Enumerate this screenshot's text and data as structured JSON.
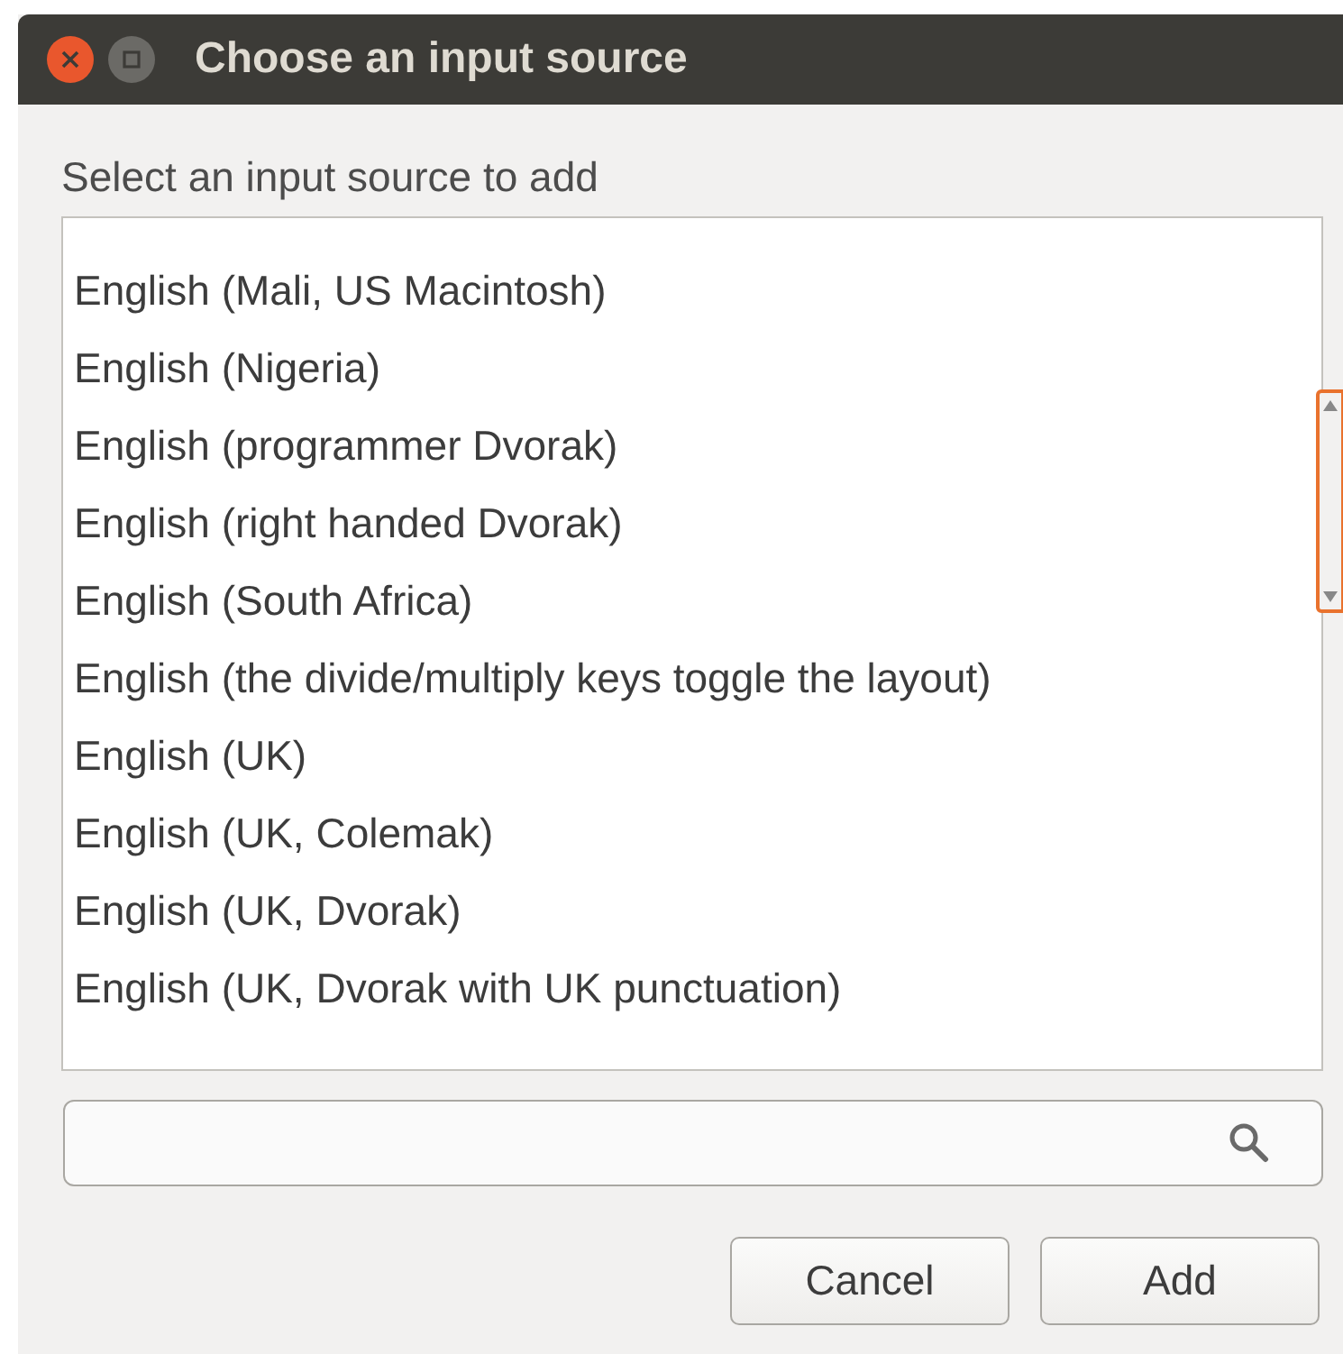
{
  "window": {
    "title": "Choose an input source"
  },
  "prompt": "Select an input source to add",
  "list": {
    "items": [
      {
        "label": "English (Mali, US Macintosh)",
        "selected": false
      },
      {
        "label": "English (Nigeria)",
        "selected": false
      },
      {
        "label": "English (programmer Dvorak)",
        "selected": false
      },
      {
        "label": "English (right handed Dvorak)",
        "selected": false
      },
      {
        "label": "English (South Africa)",
        "selected": false
      },
      {
        "label": "English (the divide/multiply keys toggle the layout)",
        "selected": false
      },
      {
        "label": "English (UK)",
        "selected": false
      },
      {
        "label": "English (UK, Colemak)",
        "selected": false
      },
      {
        "label": "English (UK, Dvorak)",
        "selected": false
      },
      {
        "label": "English (UK, Dvorak with UK punctuation)",
        "selected": false
      }
    ]
  },
  "buttons": [
    {
      "label": "Cancel"
    },
    {
      "label": "Add"
    }
  ]
}
